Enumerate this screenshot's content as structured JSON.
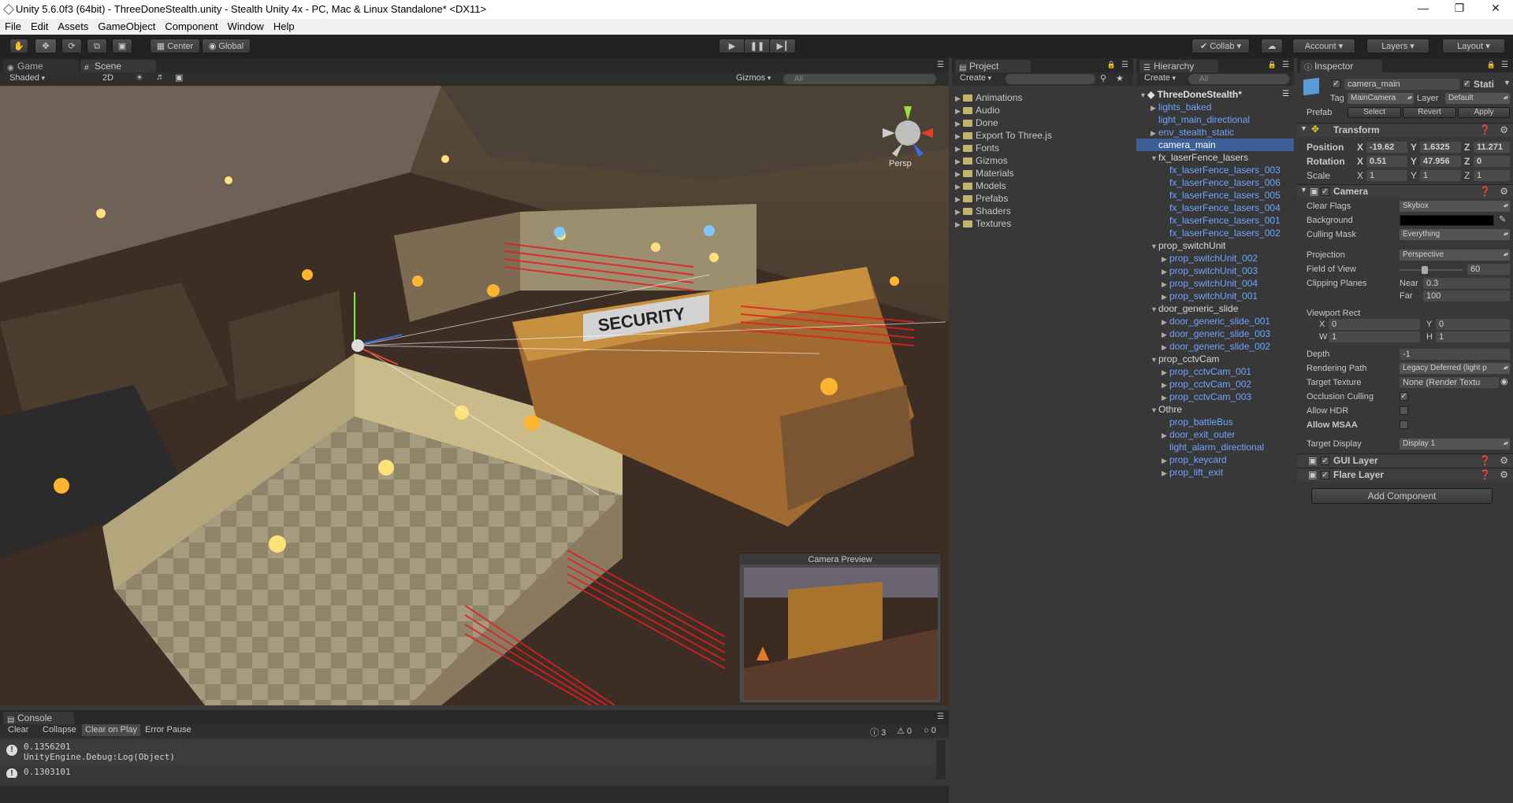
{
  "window": {
    "title": "Unity 5.6.0f3 (64bit) - ThreeDoneStealth.unity - Stealth Unity 4x - PC, Mac & Linux Standalone* <DX11>"
  },
  "menu": [
    "File",
    "Edit",
    "Assets",
    "GameObject",
    "Component",
    "Window",
    "Help"
  ],
  "toolbar": {
    "pivot_label": "Center",
    "space_label": "Global",
    "collab_label": "Collab",
    "account_label": "Account",
    "layers_label": "Layers",
    "layout_label": "Layout"
  },
  "scene_panel": {
    "tabs": [
      {
        "label": "Game",
        "icon": "game-icon"
      },
      {
        "label": "Scene",
        "icon": "scene-icon"
      }
    ],
    "shading_mode": "Shaded",
    "mode_2d": "2D",
    "gizmos_label": "Gizmos",
    "search_placeholder": "All",
    "persp_label": "Persp",
    "camera_preview_title": "Camera Preview"
  },
  "project_panel": {
    "tab": "Project",
    "create_label": "Create",
    "folders": [
      "Animations",
      "Audio",
      "Done",
      "Export To Three.js",
      "Fonts",
      "Gizmos",
      "Materials",
      "Models",
      "Prefabs",
      "Shaders",
      "Textures"
    ]
  },
  "hierarchy_panel": {
    "tab": "Hierarchy",
    "create_label": "Create",
    "search_placeholder": "All",
    "scene_name": "ThreeDoneStealth*",
    "items": [
      {
        "label": "lights_baked",
        "indent": 1,
        "arrow": "right",
        "color": "blue"
      },
      {
        "label": "light_main_directional",
        "indent": 1,
        "arrow": "",
        "color": "blue"
      },
      {
        "label": "env_stealth_static",
        "indent": 1,
        "arrow": "right",
        "color": "blue"
      },
      {
        "label": "camera_main",
        "indent": 1,
        "arrow": "",
        "color": "selected"
      },
      {
        "label": "fx_laserFence_lasers",
        "indent": 1,
        "arrow": "down",
        "color": "white"
      },
      {
        "label": "fx_laserFence_lasers_003",
        "indent": 2,
        "arrow": "",
        "color": "blue"
      },
      {
        "label": "fx_laserFence_lasers_006",
        "indent": 2,
        "arrow": "",
        "color": "blue"
      },
      {
        "label": "fx_laserFence_lasers_005",
        "indent": 2,
        "arrow": "",
        "color": "blue"
      },
      {
        "label": "fx_laserFence_lasers_004",
        "indent": 2,
        "arrow": "",
        "color": "blue"
      },
      {
        "label": "fx_laserFence_lasers_001",
        "indent": 2,
        "arrow": "",
        "color": "blue"
      },
      {
        "label": "fx_laserFence_lasers_002",
        "indent": 2,
        "arrow": "",
        "color": "blue"
      },
      {
        "label": "prop_switchUnit",
        "indent": 1,
        "arrow": "down",
        "color": "white"
      },
      {
        "label": "prop_switchUnit_002",
        "indent": 2,
        "arrow": "right",
        "color": "blue"
      },
      {
        "label": "prop_switchUnit_003",
        "indent": 2,
        "arrow": "right",
        "color": "blue"
      },
      {
        "label": "prop_switchUnit_004",
        "indent": 2,
        "arrow": "right",
        "color": "blue"
      },
      {
        "label": "prop_switchUnit_001",
        "indent": 2,
        "arrow": "right",
        "color": "blue"
      },
      {
        "label": "door_generic_slide",
        "indent": 1,
        "arrow": "down",
        "color": "white"
      },
      {
        "label": "door_generic_slide_001",
        "indent": 2,
        "arrow": "right",
        "color": "blue"
      },
      {
        "label": "door_generic_slide_003",
        "indent": 2,
        "arrow": "right",
        "color": "blue"
      },
      {
        "label": "door_generic_slide_002",
        "indent": 2,
        "arrow": "right",
        "color": "blue"
      },
      {
        "label": "prop_cctvCam",
        "indent": 1,
        "arrow": "down",
        "color": "white"
      },
      {
        "label": "prop_cctvCam_001",
        "indent": 2,
        "arrow": "right",
        "color": "blue"
      },
      {
        "label": "prop_cctvCam_002",
        "indent": 2,
        "arrow": "right",
        "color": "blue"
      },
      {
        "label": "prop_cctvCam_003",
        "indent": 2,
        "arrow": "right",
        "color": "blue"
      },
      {
        "label": "Othre",
        "indent": 1,
        "arrow": "down",
        "color": "white"
      },
      {
        "label": "prop_battleBus",
        "indent": 2,
        "arrow": "",
        "color": "blue"
      },
      {
        "label": "door_exit_outer",
        "indent": 2,
        "arrow": "right",
        "color": "blue"
      },
      {
        "label": "light_alarm_directional",
        "indent": 2,
        "arrow": "",
        "color": "blue"
      },
      {
        "label": "prop_keycard",
        "indent": 2,
        "arrow": "right",
        "color": "blue"
      },
      {
        "label": "prop_lift_exit",
        "indent": 2,
        "arrow": "right",
        "color": "blue"
      }
    ]
  },
  "inspector": {
    "tab": "Inspector",
    "object_name": "camera_main",
    "static_label": "Stati",
    "tag_label": "Tag",
    "tag_value": "MainCamera",
    "layer_label": "Layer",
    "layer_value": "Default",
    "prefab_label": "Prefab",
    "prefab_select": "Select",
    "prefab_revert": "Revert",
    "prefab_apply": "Apply",
    "transform": {
      "title": "Transform",
      "position_label": "Position",
      "rotation_label": "Rotation",
      "scale_label": "Scale",
      "position": {
        "x": "-19.62",
        "y": "1.6325",
        "z": "11.271"
      },
      "rotation": {
        "x": "0.51",
        "y": "47.956",
        "z": "0"
      },
      "scale": {
        "x": "1",
        "y": "1",
        "z": "1"
      }
    },
    "camera": {
      "title": "Camera",
      "fields": {
        "clear_flags": {
          "label": "Clear Flags",
          "value": "Skybox"
        },
        "background": {
          "label": "Background"
        },
        "culling_mask": {
          "label": "Culling Mask",
          "value": "Everything"
        },
        "projection": {
          "label": "Projection",
          "value": "Perspective"
        },
        "fov": {
          "label": "Field of View",
          "value": "60"
        },
        "clipping": {
          "label": "Clipping Planes",
          "near_label": "Near",
          "near": "0.3",
          "far_label": "Far",
          "far": "100"
        },
        "viewport": {
          "label": "Viewport Rect",
          "x": "0",
          "y": "0",
          "w": "1",
          "h": "1"
        },
        "depth": {
          "label": "Depth",
          "value": "-1"
        },
        "rendering_path": {
          "label": "Rendering Path",
          "value": "Legacy Deferred (light p"
        },
        "target_texture": {
          "label": "Target Texture",
          "value": "None (Render Textu"
        },
        "occlusion_culling": {
          "label": "Occlusion Culling"
        },
        "allow_hdr": {
          "label": "Allow HDR"
        },
        "allow_msaa": {
          "label": "Allow MSAA"
        },
        "target_display": {
          "label": "Target Display",
          "value": "Display 1"
        }
      }
    },
    "gui_layer": "GUI Layer",
    "flare_layer": "Flare Layer",
    "add_component": "Add Component",
    "colors": {
      "background_swatch": "#000000"
    }
  },
  "console": {
    "tab": "Console",
    "buttons": [
      "Clear",
      "Collapse",
      "Clear on Play",
      "Error Pause"
    ],
    "counts": {
      "info": "3",
      "warn": "0",
      "error": "0"
    },
    "messages": [
      {
        "line1": "0.1356201",
        "line2": "UnityEngine.Debug:Log(Object)"
      },
      {
        "line1": "0.1303101",
        "line2": ""
      }
    ]
  }
}
